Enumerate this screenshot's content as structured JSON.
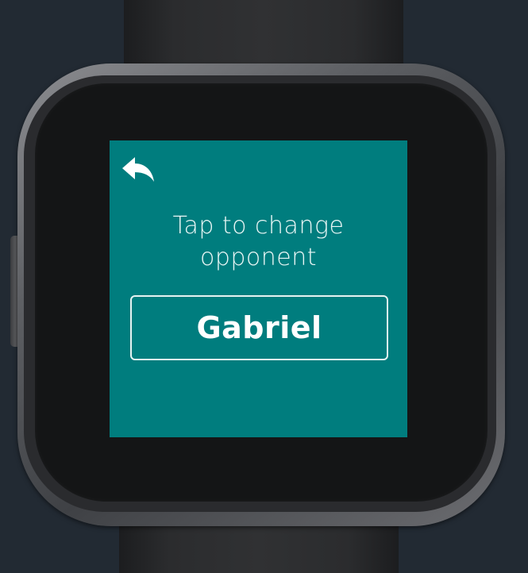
{
  "screen": {
    "background_color": "#007d7e",
    "back_icon": "reply-arrow-icon",
    "prompt_line1": "Tap to change",
    "prompt_line2": "opponent",
    "opponent_name": "Gabriel"
  },
  "device": {
    "type": "smartwatch"
  }
}
